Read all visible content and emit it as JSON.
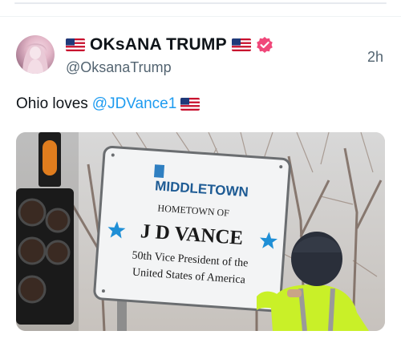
{
  "tweet": {
    "display_name": "OKsANA TRUMP",
    "handle": "@OksanaTrump",
    "timestamp": "2h",
    "text_before": "Ohio loves",
    "mention": "@JDVance1",
    "verified": true,
    "name_flags": [
      "us-flag-icon",
      "us-flag-icon"
    ],
    "text_flag": "us-flag-icon",
    "verified_color": "#f0487a",
    "mention_color": "#1d9bf0"
  },
  "media": {
    "sign": {
      "logo": "MIDDLETOWN",
      "line1": "HOMETOWN OF",
      "line2": "J D  VANCE",
      "line3": "50th Vice President of the",
      "line4": "United States of America"
    }
  }
}
